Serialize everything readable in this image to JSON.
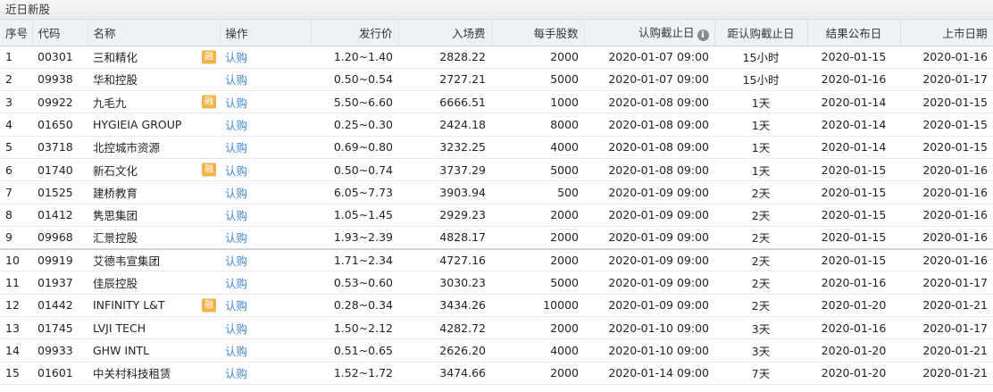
{
  "window": {
    "title": "近日新股"
  },
  "columns": {
    "index": "序号",
    "code": "代码",
    "name": "名称",
    "action": "操作",
    "price": "发行价",
    "entry_fee": "入场费",
    "lot_size": "每手股数",
    "deadline": "认购截止日",
    "countdown": "距认购截止日",
    "result_date": "结果公布日",
    "listing_date": "上市日期"
  },
  "info_icon_glyph": "i",
  "badge_label": "融",
  "action_label": "认购",
  "rows": [
    {
      "index": "1",
      "code": "00301",
      "name": "三和精化",
      "badge": true,
      "price": "1.20~1.40",
      "entry_fee": "2828.22",
      "lot_size": "2000",
      "deadline": "2020-01-07 09:00",
      "countdown": "15小时",
      "result_date": "2020-01-15",
      "listing_date": "2020-01-16"
    },
    {
      "index": "2",
      "code": "09938",
      "name": "华和控股",
      "badge": false,
      "price": "0.50~0.54",
      "entry_fee": "2727.21",
      "lot_size": "5000",
      "deadline": "2020-01-07 09:00",
      "countdown": "15小时",
      "result_date": "2020-01-16",
      "listing_date": "2020-01-17"
    },
    {
      "index": "3",
      "code": "09922",
      "name": "九毛九",
      "badge": true,
      "price": "5.50~6.60",
      "entry_fee": "6666.51",
      "lot_size": "1000",
      "deadline": "2020-01-08 09:00",
      "countdown": "1天",
      "result_date": "2020-01-14",
      "listing_date": "2020-01-15"
    },
    {
      "index": "4",
      "code": "01650",
      "name": "HYGIEIA GROUP",
      "badge": false,
      "price": "0.25~0.30",
      "entry_fee": "2424.18",
      "lot_size": "8000",
      "deadline": "2020-01-08 09:00",
      "countdown": "1天",
      "result_date": "2020-01-14",
      "listing_date": "2020-01-15"
    },
    {
      "index": "5",
      "code": "03718",
      "name": "北控城市资源",
      "badge": false,
      "price": "0.69~0.80",
      "entry_fee": "3232.25",
      "lot_size": "4000",
      "deadline": "2020-01-08 09:00",
      "countdown": "1天",
      "result_date": "2020-01-14",
      "listing_date": "2020-01-15"
    },
    {
      "index": "6",
      "code": "01740",
      "name": "新石文化",
      "badge": true,
      "price": "0.50~0.74",
      "entry_fee": "3737.29",
      "lot_size": "5000",
      "deadline": "2020-01-08 09:00",
      "countdown": "1天",
      "result_date": "2020-01-15",
      "listing_date": "2020-01-16"
    },
    {
      "index": "7",
      "code": "01525",
      "name": "建桥教育",
      "badge": false,
      "price": "6.05~7.73",
      "entry_fee": "3903.94",
      "lot_size": "500",
      "deadline": "2020-01-09 09:00",
      "countdown": "2天",
      "result_date": "2020-01-15",
      "listing_date": "2020-01-16"
    },
    {
      "index": "8",
      "code": "01412",
      "name": "隽思集团",
      "badge": false,
      "price": "1.05~1.45",
      "entry_fee": "2929.23",
      "lot_size": "2000",
      "deadline": "2020-01-09 09:00",
      "countdown": "2天",
      "result_date": "2020-01-15",
      "listing_date": "2020-01-16"
    },
    {
      "index": "9",
      "code": "09968",
      "name": "汇景控股",
      "badge": false,
      "price": "1.93~2.39",
      "entry_fee": "4828.17",
      "lot_size": "2000",
      "deadline": "2020-01-09 09:00",
      "countdown": "2天",
      "result_date": "2020-01-15",
      "listing_date": "2020-01-16"
    },
    {
      "index": "10",
      "code": "09919",
      "name": "艾德韦宣集团",
      "badge": false,
      "price": "1.71~2.34",
      "entry_fee": "4727.16",
      "lot_size": "2000",
      "deadline": "2020-01-09 09:00",
      "countdown": "2天",
      "result_date": "2020-01-15",
      "listing_date": "2020-01-16"
    },
    {
      "index": "11",
      "code": "01937",
      "name": "佳辰控股",
      "badge": false,
      "price": "0.53~0.60",
      "entry_fee": "3030.23",
      "lot_size": "5000",
      "deadline": "2020-01-09 09:00",
      "countdown": "2天",
      "result_date": "2020-01-16",
      "listing_date": "2020-01-17"
    },
    {
      "index": "12",
      "code": "01442",
      "name": "INFINITY L&T",
      "badge": true,
      "price": "0.28~0.34",
      "entry_fee": "3434.26",
      "lot_size": "10000",
      "deadline": "2020-01-09 09:00",
      "countdown": "2天",
      "result_date": "2020-01-20",
      "listing_date": "2020-01-21"
    },
    {
      "index": "13",
      "code": "01745",
      "name": "LVJI TECH",
      "badge": false,
      "price": "1.50~2.12",
      "entry_fee": "4282.72",
      "lot_size": "2000",
      "deadline": "2020-01-10 09:00",
      "countdown": "3天",
      "result_date": "2020-01-16",
      "listing_date": "2020-01-17"
    },
    {
      "index": "14",
      "code": "09933",
      "name": "GHW INTL",
      "badge": false,
      "price": "0.51~0.65",
      "entry_fee": "2626.20",
      "lot_size": "4000",
      "deadline": "2020-01-10 09:00",
      "countdown": "3天",
      "result_date": "2020-01-20",
      "listing_date": "2020-01-21"
    },
    {
      "index": "15",
      "code": "01601",
      "name": "中关村科技租赁",
      "badge": false,
      "price": "1.52~1.72",
      "entry_fee": "3474.66",
      "lot_size": "2000",
      "deadline": "2020-01-14 09:00",
      "countdown": "7天",
      "result_date": "2020-01-20",
      "listing_date": "2020-01-21"
    }
  ]
}
